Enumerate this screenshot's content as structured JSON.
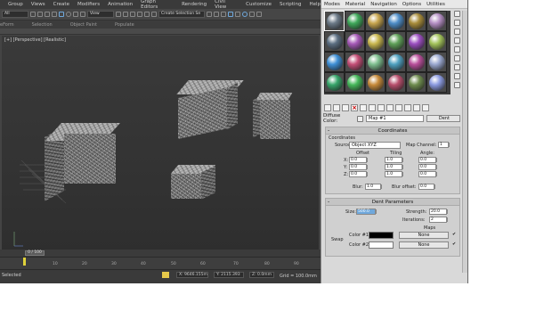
{
  "menu": [
    "Group",
    "Views",
    "Create",
    "Modifiers",
    "Animation",
    "Graph Editors",
    "Rendering",
    "Civil View",
    "Customize",
    "Scripting",
    "Help"
  ],
  "toolbar": {
    "filter": "All",
    "view": "View",
    "selection_set": "Create Selection Se"
  },
  "ribbon_tabs": [
    "eForm",
    "Selection",
    "Object Paint",
    "Populate"
  ],
  "viewport": {
    "label": "[+] [Perspective] [Realistic]"
  },
  "timeline": {
    "frame": "0 / 100",
    "ticks": [
      "10",
      "20",
      "30",
      "40",
      "50",
      "60",
      "70",
      "80",
      "90"
    ]
  },
  "status": {
    "selected": "Selected",
    "x": "X: 9646.155m",
    "y": "Y: 2115.393",
    "z": "Z: 0.0mm",
    "grid": "Grid = 100.0mm"
  },
  "mated": {
    "menu": [
      "Modes",
      "Material",
      "Navigation",
      "Options",
      "Utilities"
    ],
    "slot_colors": [
      "#6c7a88",
      "#3fa85a",
      "#c7a54e",
      "#4e8dc8",
      "#a88c3a",
      "#b58fc4",
      "#5c6f82",
      "#a659b8",
      "#c9b74e",
      "#5fa058",
      "#9b4ec0",
      "#a2c25a",
      "#3e8fd6",
      "#c44e76",
      "#7ebf8f",
      "#4ea0c0",
      "#b84e9a",
      "#9aa8d0",
      "#37a56a",
      "#45b85a",
      "#c78a3a",
      "#b84e6c",
      "#6e8c4e",
      "#8b9ae0"
    ],
    "diffuse_label": "Diffuse Color:",
    "map_name": "Map #1",
    "map_type": "Dent",
    "coordinates": {
      "title": "Coordinates",
      "group": "Coordinates",
      "source_label": "Source:",
      "source_value": "Object XYZ",
      "map_channel_label": "Map Channel:",
      "map_channel_value": "1",
      "offset_label": "Offset",
      "tiling_label": "Tiling",
      "angle_label": "Angle:",
      "axes": [
        "X:",
        "Y:",
        "Z:"
      ],
      "offset": [
        "0.0",
        "0.0",
        "0.0"
      ],
      "tiling": [
        "1.0",
        "1.0",
        "1.0"
      ],
      "angle": [
        "0.0",
        "0.0",
        "0.0"
      ],
      "blur_label": "Blur:",
      "blur_value": "1.0",
      "blur_offset_label": "Blur offset:",
      "blur_offset_value": "0.0"
    },
    "dent": {
      "title": "Dent Parameters",
      "size_label": "Size:",
      "size_value": "500.0",
      "strength_label": "Strength:",
      "strength_value": "20.0",
      "iterations_label": "Iterations:",
      "iterations_value": "2",
      "maps_label": "Maps",
      "swap_label": "Swap",
      "color1_label": "Color #1",
      "color2_label": "Color #2",
      "color1": "#000000",
      "color2": "#ffffff",
      "none1": "None",
      "none2": "None",
      "check": "✔"
    }
  }
}
